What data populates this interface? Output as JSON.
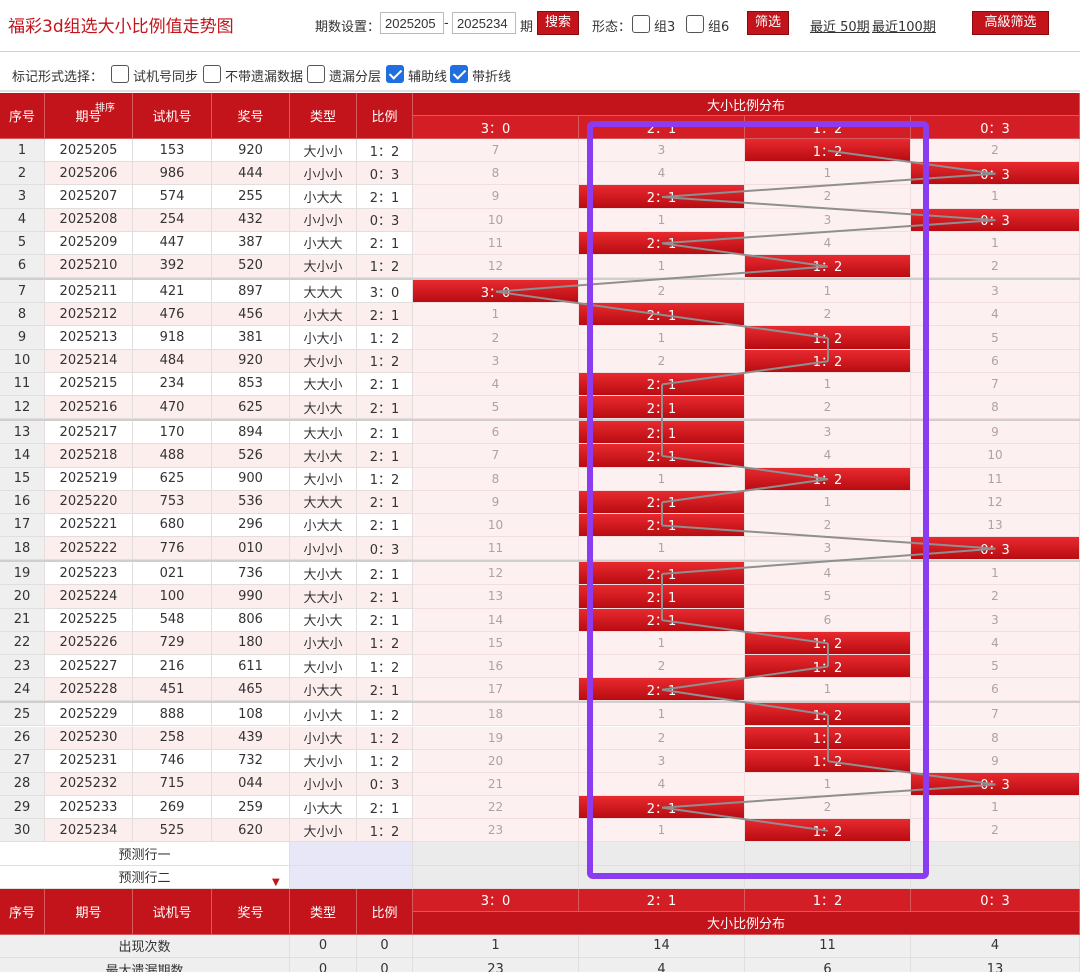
{
  "header": {
    "title": "福彩3d组选大小比例值走势图",
    "period_label": "期数设置：",
    "start_issue": "2025205",
    "dash": "-",
    "end_issue": "2025234",
    "issue_suffix": "期",
    "search_label": "搜索",
    "shape_label": "形态：",
    "group3_label": "组3",
    "group6_label": "组6",
    "filter_label": "筛选",
    "recent50_label": "最近 50期",
    "recent100_label": "最近100期",
    "advanced_label": "高級筛选"
  },
  "options": {
    "mark_label": "标记形式选择：",
    "items": [
      {
        "label": "试机号同步",
        "checked": false
      },
      {
        "label": "不带遗漏数据",
        "checked": false
      },
      {
        "label": "遗漏分层",
        "checked": false
      },
      {
        "label": "辅助线",
        "checked": true
      },
      {
        "label": "带折线",
        "checked": true
      }
    ]
  },
  "table": {
    "headers": {
      "seq": "序号",
      "issue": "期号",
      "sort": "排序",
      "trial": "试机号",
      "prize": "奖号",
      "type": "类型",
      "ratio": "比例",
      "dist": "大小比例分布"
    },
    "dist_columns": [
      "3：0",
      "2：1",
      "1：2",
      "0：3"
    ],
    "rows": [
      {
        "seq": "1",
        "issue": "2025205",
        "trial": "153",
        "prize": "920",
        "type": "大小小",
        "ratio": "1：2",
        "dist": [
          "7",
          "3",
          "1：2",
          "2"
        ]
      },
      {
        "seq": "2",
        "issue": "2025206",
        "trial": "986",
        "prize": "444",
        "type": "小小小",
        "ratio": "0：3",
        "dist": [
          "8",
          "4",
          "1",
          "0：3"
        ]
      },
      {
        "seq": "3",
        "issue": "2025207",
        "trial": "574",
        "prize": "255",
        "type": "小大大",
        "ratio": "2：1",
        "dist": [
          "9",
          "2：1",
          "2",
          "1"
        ]
      },
      {
        "seq": "4",
        "issue": "2025208",
        "trial": "254",
        "prize": "432",
        "type": "小小小",
        "ratio": "0：3",
        "dist": [
          "10",
          "1",
          "3",
          "0：3"
        ]
      },
      {
        "seq": "5",
        "issue": "2025209",
        "trial": "447",
        "prize": "387",
        "type": "小大大",
        "ratio": "2：1",
        "dist": [
          "11",
          "2：1",
          "4",
          "1"
        ]
      },
      {
        "seq": "6",
        "issue": "2025210",
        "trial": "392",
        "prize": "520",
        "type": "大小小",
        "ratio": "1：2",
        "dist": [
          "12",
          "1",
          "1：2",
          "2"
        ]
      },
      {
        "seq": "7",
        "issue": "2025211",
        "trial": "421",
        "prize": "897",
        "type": "大大大",
        "ratio": "3：0",
        "dist": [
          "3：0",
          "2",
          "1",
          "3"
        ]
      },
      {
        "seq": "8",
        "issue": "2025212",
        "trial": "476",
        "prize": "456",
        "type": "小大大",
        "ratio": "2：1",
        "dist": [
          "1",
          "2：1",
          "2",
          "4"
        ]
      },
      {
        "seq": "9",
        "issue": "2025213",
        "trial": "918",
        "prize": "381",
        "type": "小大小",
        "ratio": "1：2",
        "dist": [
          "2",
          "1",
          "1：2",
          "5"
        ]
      },
      {
        "seq": "10",
        "issue": "2025214",
        "trial": "484",
        "prize": "920",
        "type": "大小小",
        "ratio": "1：2",
        "dist": [
          "3",
          "2",
          "1：2",
          "6"
        ]
      },
      {
        "seq": "11",
        "issue": "2025215",
        "trial": "234",
        "prize": "853",
        "type": "大大小",
        "ratio": "2：1",
        "dist": [
          "4",
          "2：1",
          "1",
          "7"
        ]
      },
      {
        "seq": "12",
        "issue": "2025216",
        "trial": "470",
        "prize": "625",
        "type": "大小大",
        "ratio": "2：1",
        "dist": [
          "5",
          "2：1",
          "2",
          "8"
        ]
      },
      {
        "seq": "13",
        "issue": "2025217",
        "trial": "170",
        "prize": "894",
        "type": "大大小",
        "ratio": "2：1",
        "dist": [
          "6",
          "2：1",
          "3",
          "9"
        ]
      },
      {
        "seq": "14",
        "issue": "2025218",
        "trial": "488",
        "prize": "526",
        "type": "大小大",
        "ratio": "2：1",
        "dist": [
          "7",
          "2：1",
          "4",
          "10"
        ]
      },
      {
        "seq": "15",
        "issue": "2025219",
        "trial": "625",
        "prize": "900",
        "type": "大小小",
        "ratio": "1：2",
        "dist": [
          "8",
          "1",
          "1：2",
          "11"
        ]
      },
      {
        "seq": "16",
        "issue": "2025220",
        "trial": "753",
        "prize": "536",
        "type": "大大大",
        "ratio": "2：1",
        "dist": [
          "9",
          "2：1",
          "1",
          "12"
        ]
      },
      {
        "seq": "17",
        "issue": "2025221",
        "trial": "680",
        "prize": "296",
        "type": "小大大",
        "ratio": "2：1",
        "dist": [
          "10",
          "2：1",
          "2",
          "13"
        ]
      },
      {
        "seq": "18",
        "issue": "2025222",
        "trial": "776",
        "prize": "010",
        "type": "小小小",
        "ratio": "0：3",
        "dist": [
          "11",
          "1",
          "3",
          "0：3"
        ]
      },
      {
        "seq": "19",
        "issue": "2025223",
        "trial": "021",
        "prize": "736",
        "type": "大小大",
        "ratio": "2：1",
        "dist": [
          "12",
          "2：1",
          "4",
          "1"
        ]
      },
      {
        "seq": "20",
        "issue": "2025224",
        "trial": "100",
        "prize": "990",
        "type": "大大小",
        "ratio": "2：1",
        "dist": [
          "13",
          "2：1",
          "5",
          "2"
        ]
      },
      {
        "seq": "21",
        "issue": "2025225",
        "trial": "548",
        "prize": "806",
        "type": "大小大",
        "ratio": "2：1",
        "dist": [
          "14",
          "2：1",
          "6",
          "3"
        ]
      },
      {
        "seq": "22",
        "issue": "2025226",
        "trial": "729",
        "prize": "180",
        "type": "小大小",
        "ratio": "1：2",
        "dist": [
          "15",
          "1",
          "1：2",
          "4"
        ]
      },
      {
        "seq": "23",
        "issue": "2025227",
        "trial": "216",
        "prize": "611",
        "type": "大小小",
        "ratio": "1：2",
        "dist": [
          "16",
          "2",
          "1：2",
          "5"
        ]
      },
      {
        "seq": "24",
        "issue": "2025228",
        "trial": "451",
        "prize": "465",
        "type": "小大大",
        "ratio": "2：1",
        "dist": [
          "17",
          "2：1",
          "1",
          "6"
        ]
      },
      {
        "seq": "25",
        "issue": "2025229",
        "trial": "888",
        "prize": "108",
        "type": "小小大",
        "ratio": "1：2",
        "dist": [
          "18",
          "1",
          "1：2",
          "7"
        ]
      },
      {
        "seq": "26",
        "issue": "2025230",
        "trial": "258",
        "prize": "439",
        "type": "小小大",
        "ratio": "1：2",
        "dist": [
          "19",
          "2",
          "1：2",
          "8"
        ]
      },
      {
        "seq": "27",
        "issue": "2025231",
        "trial": "746",
        "prize": "732",
        "type": "大小小",
        "ratio": "1：2",
        "dist": [
          "20",
          "3",
          "1：2",
          "9"
        ]
      },
      {
        "seq": "28",
        "issue": "2025232",
        "trial": "715",
        "prize": "044",
        "type": "小小小",
        "ratio": "0：3",
        "dist": [
          "21",
          "4",
          "1",
          "0：3"
        ]
      },
      {
        "seq": "29",
        "issue": "2025233",
        "trial": "269",
        "prize": "259",
        "type": "小大大",
        "ratio": "2：1",
        "dist": [
          "22",
          "2：1",
          "2",
          "1"
        ]
      },
      {
        "seq": "30",
        "issue": "2025234",
        "trial": "525",
        "prize": "620",
        "type": "大小小",
        "ratio": "1：2",
        "dist": [
          "23",
          "1",
          "1：2",
          "2"
        ]
      }
    ],
    "hit_columns": [
      2,
      3,
      1,
      3,
      1,
      2,
      0,
      1,
      2,
      2,
      1,
      1,
      1,
      1,
      2,
      1,
      1,
      3,
      1,
      1,
      1,
      2,
      2,
      1,
      2,
      2,
      2,
      3,
      1,
      2
    ],
    "predict_rows": [
      "预测行一",
      "预测行二"
    ],
    "stats": [
      {
        "label": "出现次数",
        "type": "0",
        "ratio": "0",
        "values": [
          "1",
          "14",
          "11",
          "4"
        ]
      },
      {
        "label": "最大遗漏期数",
        "type": "0",
        "ratio": "0",
        "values": [
          "23",
          "4",
          "6",
          "13"
        ]
      }
    ]
  },
  "colors": {
    "accent": "#c4141b",
    "highlight": "#8c3cf0",
    "checkbox": "#1f6fe0"
  }
}
